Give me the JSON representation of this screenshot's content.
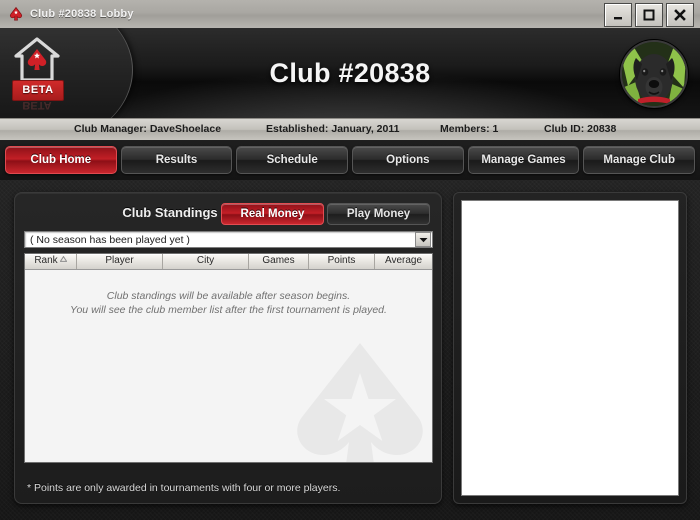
{
  "window": {
    "title": "Club #20838 Lobby",
    "app_icon": "pokerstars-spade-icon",
    "buttons": {
      "minimize": "minimize-button",
      "maximize": "maximize-button",
      "close": "close-button"
    }
  },
  "header": {
    "logo_alt": "PokerStars Home Games",
    "beta_label": "BETA",
    "club_title": "Club #20838",
    "avatar_alt": "Club avatar: black dog"
  },
  "info_bar": {
    "manager": "Club Manager: DaveShoelace",
    "established": "Established: January, 2011",
    "members": "Members: 1",
    "club_id": "Club ID: 20838"
  },
  "nav": {
    "tabs": [
      {
        "label": "Club Home",
        "active": true
      },
      {
        "label": "Results",
        "active": false
      },
      {
        "label": "Schedule",
        "active": false
      },
      {
        "label": "Options",
        "active": false
      },
      {
        "label": "Manage Games",
        "active": false
      },
      {
        "label": "Manage Club",
        "active": false
      }
    ]
  },
  "standings": {
    "title": "Club Standings",
    "money_toggle": {
      "real_money": "Real Money",
      "play_money": "Play Money",
      "selected": "Real Money"
    },
    "season_select": {
      "value": "( No season has been played yet )",
      "options": [
        "( No season has been played yet )"
      ]
    },
    "columns": [
      {
        "label": "Rank",
        "sort": "ascending"
      },
      {
        "label": "Player",
        "sort": null
      },
      {
        "label": "City",
        "sort": null
      },
      {
        "label": "Games",
        "sort": null
      },
      {
        "label": "Points",
        "sort": null
      },
      {
        "label": "Average",
        "sort": null
      }
    ],
    "rows": [],
    "empty_message_line1": "Club standings will be available after season begins.",
    "empty_message_line2": "You will see the club member list after the first tournament is played.",
    "footnote": "* Points are only awarded in tournaments with four or more players."
  },
  "side_panel": {
    "content": ""
  },
  "colors": {
    "accent_red": "#c21f26",
    "panel_dark": "#1d1d1d",
    "titlebar_gray": "#a9a7a2",
    "table_bg": "#f4f4f4"
  }
}
